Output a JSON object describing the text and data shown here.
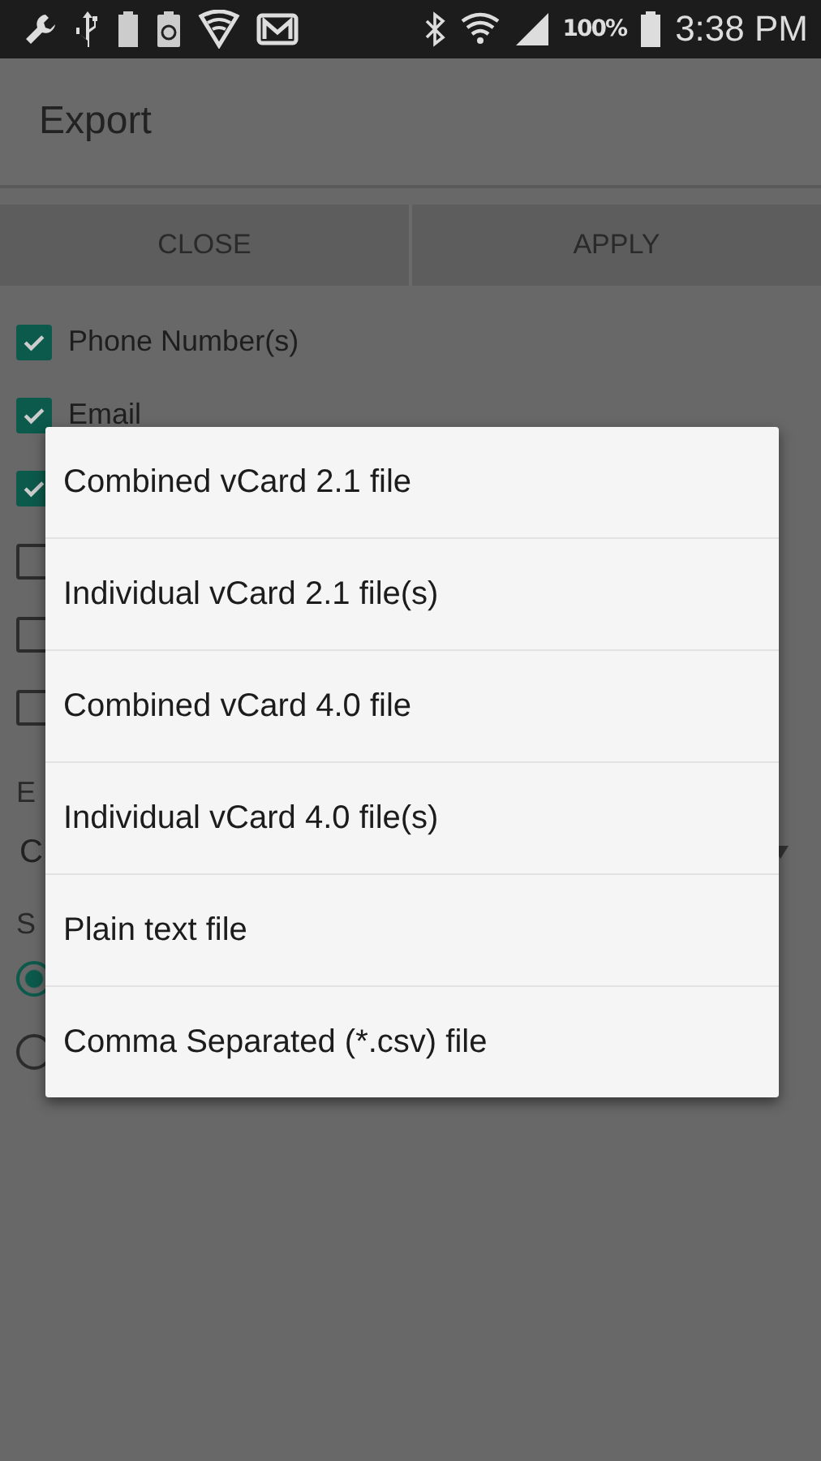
{
  "status_bar": {
    "battery_percent": "100%",
    "time": "3:38 PM"
  },
  "action_bar": {
    "title": "Export"
  },
  "buttons": [
    {
      "label": "CLOSE"
    },
    {
      "label": "APPLY"
    }
  ],
  "fields": [
    {
      "label": "Phone Number(s)",
      "checked": true
    },
    {
      "label": "Email",
      "checked": true
    },
    {
      "checked": true
    },
    {
      "checked": false
    },
    {
      "checked": false
    },
    {
      "checked": false
    }
  ],
  "export_label": "E",
  "format_spinner": {
    "value": "C"
  },
  "save_label": "S",
  "save_options": [
    {
      "selected": true
    },
    {
      "selected": false
    }
  ],
  "popup_menu": [
    {
      "label": "Combined vCard 2.1 file"
    },
    {
      "label": "Individual vCard 2.1 file(s)"
    },
    {
      "label": "Combined vCard 4.0 file"
    },
    {
      "label": "Individual vCard 4.0 file(s)"
    },
    {
      "label": "Plain text file"
    },
    {
      "label": "Comma Separated (*.csv) file"
    }
  ]
}
